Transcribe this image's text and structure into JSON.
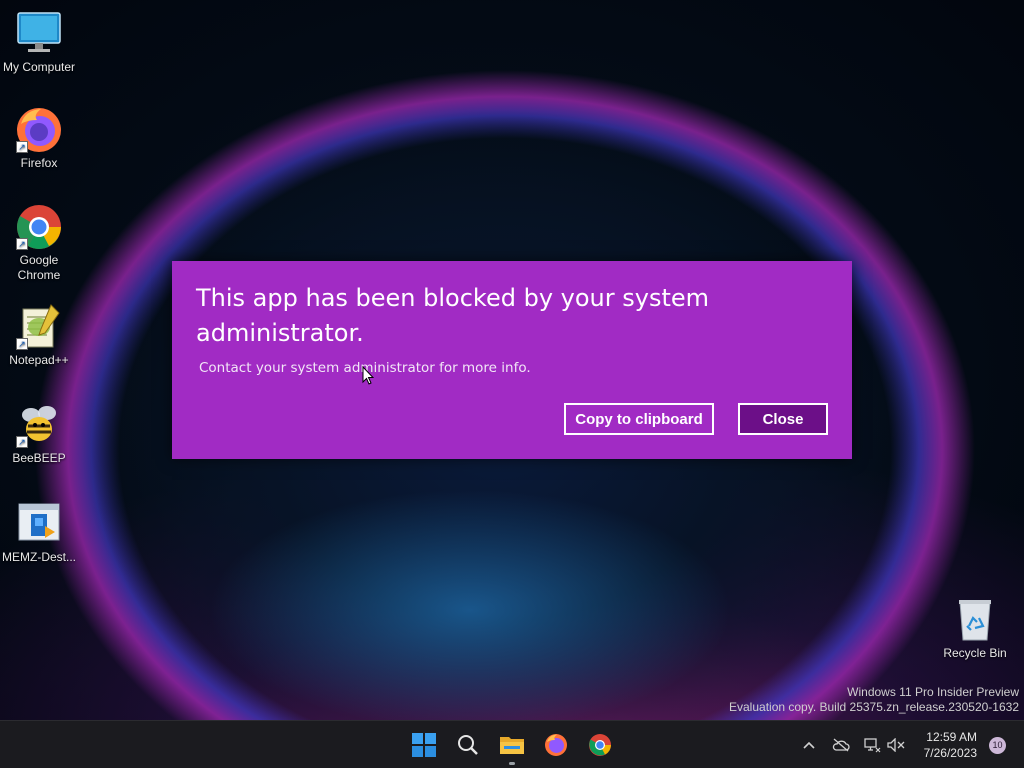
{
  "desktop": {
    "icons": [
      {
        "label": "My Computer",
        "icon": "monitor-icon"
      },
      {
        "label": "Firefox",
        "icon": "firefox-icon"
      },
      {
        "label": "Google Chrome",
        "icon": "chrome-icon"
      },
      {
        "label": "Notepad++",
        "icon": "notepadpp-icon"
      },
      {
        "label": "BeeBEEP",
        "icon": "bee-icon"
      },
      {
        "label": "MEMZ-Dest...",
        "icon": "installer-icon"
      },
      {
        "label": "Recycle Bin",
        "icon": "recycle-bin-icon"
      }
    ]
  },
  "dialog": {
    "title": "This app has been blocked by your system administrator.",
    "message": "Contact your system administrator for more info.",
    "copy_label": "Copy to clipboard",
    "close_label": "Close",
    "background": "#a12bc4",
    "close_background": "#6c0f88"
  },
  "watermark": {
    "line1": "Windows 11 Pro Insider Preview",
    "line2": "Evaluation copy. Build 25375.zn_release.230520-1632"
  },
  "taskbar": {
    "apps": [
      "start-icon",
      "search-icon",
      "file-explorer-icon",
      "firefox-icon",
      "chrome-icon"
    ],
    "tray": [
      "chevron-up-icon",
      "onedrive-offline-icon",
      "network-icon",
      "volume-muted-icon"
    ],
    "time": "12:59 AM",
    "date": "7/26/2023",
    "notification_count": "10"
  }
}
